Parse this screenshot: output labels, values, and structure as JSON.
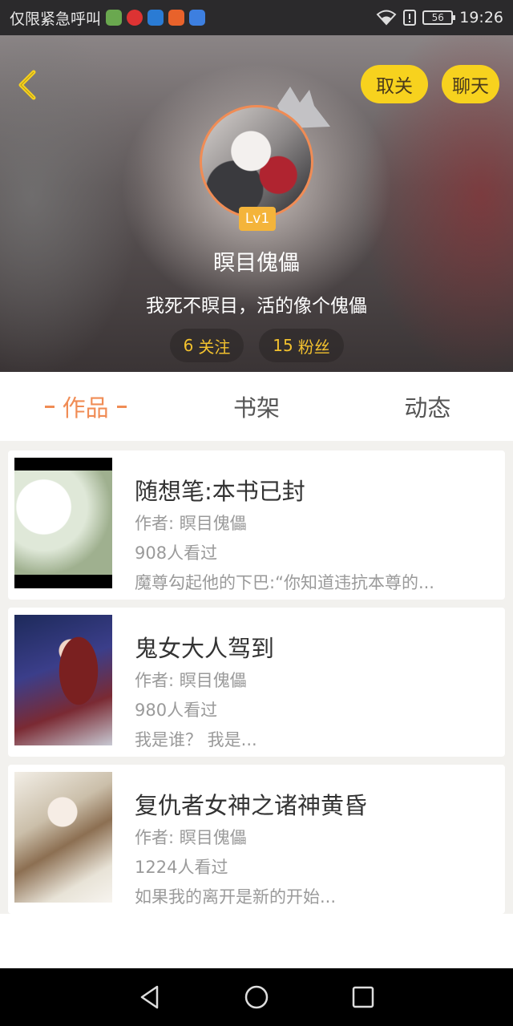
{
  "status_bar": {
    "carrier": "仅限紧急呼叫",
    "battery": "56",
    "time": "19:26",
    "app_icons": [
      "app-green-icon",
      "app-red-icon",
      "app-blue-icon",
      "app-orange-icon",
      "app-paw-icon"
    ]
  },
  "header": {
    "unfollow_label": "取关",
    "chat_label": "聊天",
    "level": "Lv1",
    "username": "瞑目傀儡",
    "signature": "我死不瞑目，活的像个傀儡",
    "following_count": "6",
    "following_label": "关注",
    "fans_count": "15",
    "fans_label": "粉丝"
  },
  "tabs": [
    {
      "label": "作品",
      "active": true
    },
    {
      "label": "书架",
      "active": false
    },
    {
      "label": "动态",
      "active": false
    }
  ],
  "books": [
    {
      "title": "随想笔:本书已封",
      "author": "作者: 瞑目傀儡",
      "views": "908人看过",
      "excerpt": "魔尊勾起他的下巴:“你知道违抗本尊的..."
    },
    {
      "title": "鬼女大人驾到",
      "author": "作者: 瞑目傀儡",
      "views": "980人看过",
      "excerpt": "我是谁？ 我是..."
    },
    {
      "title": "复仇者女神之诸神黄昏",
      "author": "作者: 瞑目傀儡",
      "views": "1224人看过",
      "excerpt": "如果我的离开是新的开始..."
    }
  ],
  "colors": {
    "accent": "#f08c55",
    "button_yellow": "#f7d21e",
    "stat_text": "#f2c12e"
  }
}
